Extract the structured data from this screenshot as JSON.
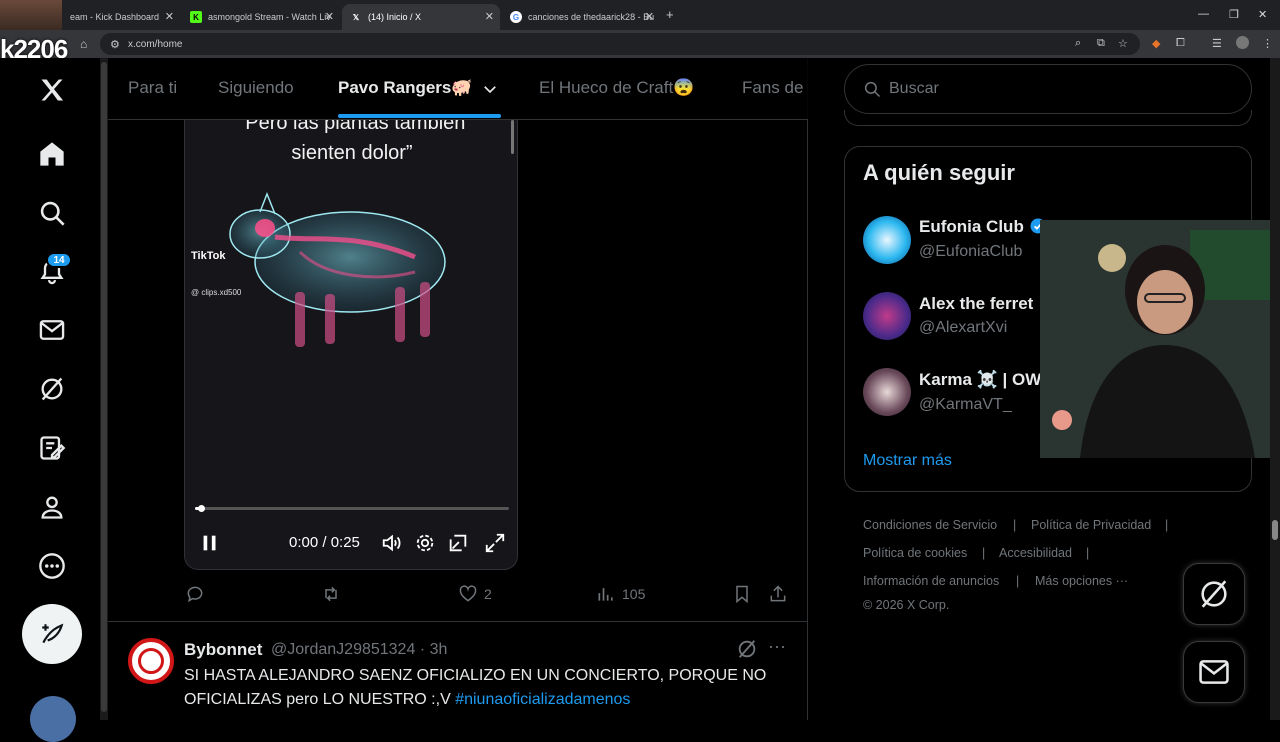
{
  "browser": {
    "tabs": [
      {
        "title": "eam - Kick Dashboard",
        "active": false
      },
      {
        "title": "asmongold Stream - Watch Liv",
        "active": false
      },
      {
        "title": "(14) Inicio / X",
        "active": true
      },
      {
        "title": "canciones de thedaarick28 - Bu",
        "active": false
      }
    ],
    "url": "x.com/home"
  },
  "streamer_label": "k2206",
  "sidebar": {
    "notification_count": "14"
  },
  "feed_tabs": [
    {
      "label": "Para ti",
      "active": false
    },
    {
      "label": "Siguiendo",
      "active": false
    },
    {
      "label": "Pavo Rangers🐖",
      "active": true
    },
    {
      "label": "El Hueco de Craft😨",
      "active": false
    },
    {
      "label": "Fans de",
      "active": false
    }
  ],
  "video": {
    "caption_line1": "“Pero las plantas también",
    "caption_line2": "sienten dolor”",
    "watermark": "TikTok",
    "watermark_handle": "@ clips.xd500",
    "time": "0:00 / 0:25",
    "progress": 0.02
  },
  "actions": {
    "likes": "2",
    "views": "105"
  },
  "post2": {
    "name": "Bybonnet",
    "handle_time": "@JordanJ29851324 · 3h",
    "text": "SI HASTA ALEJANDRO SAENZ OFICIALIZO EN UN CONCIERTO, PORQUE NO OFICIALIZAS pero LO NUESTRO :,V ",
    "hashtag": "#niunaoficializadamenos"
  },
  "right": {
    "search_placeholder": "Buscar",
    "follow_title": "A quién seguir",
    "suggestions": [
      {
        "name": "Eufonia Club",
        "handle": "@EufoniaClub",
        "verified": true
      },
      {
        "name": "Alex the ferret",
        "handle": "@AlexartXvi",
        "verified": false
      },
      {
        "name": "Karma ☠️ | OW",
        "handle": "@KarmaVT_",
        "verified": false
      }
    ],
    "show_more": "Mostrar más",
    "footer": {
      "terms": "Condiciones de Servicio",
      "privacy": "Política de Privacidad",
      "cookies": "Política de cookies",
      "accessibility": "Accesibilidad",
      "ads": "Información de anuncios",
      "more": "Más opciones ···",
      "copyright": "© 2026 X Corp."
    }
  },
  "colors": {
    "accent": "#1d9bf0",
    "background": "#000000",
    "border": "#2f3336",
    "muted": "#71767b"
  }
}
